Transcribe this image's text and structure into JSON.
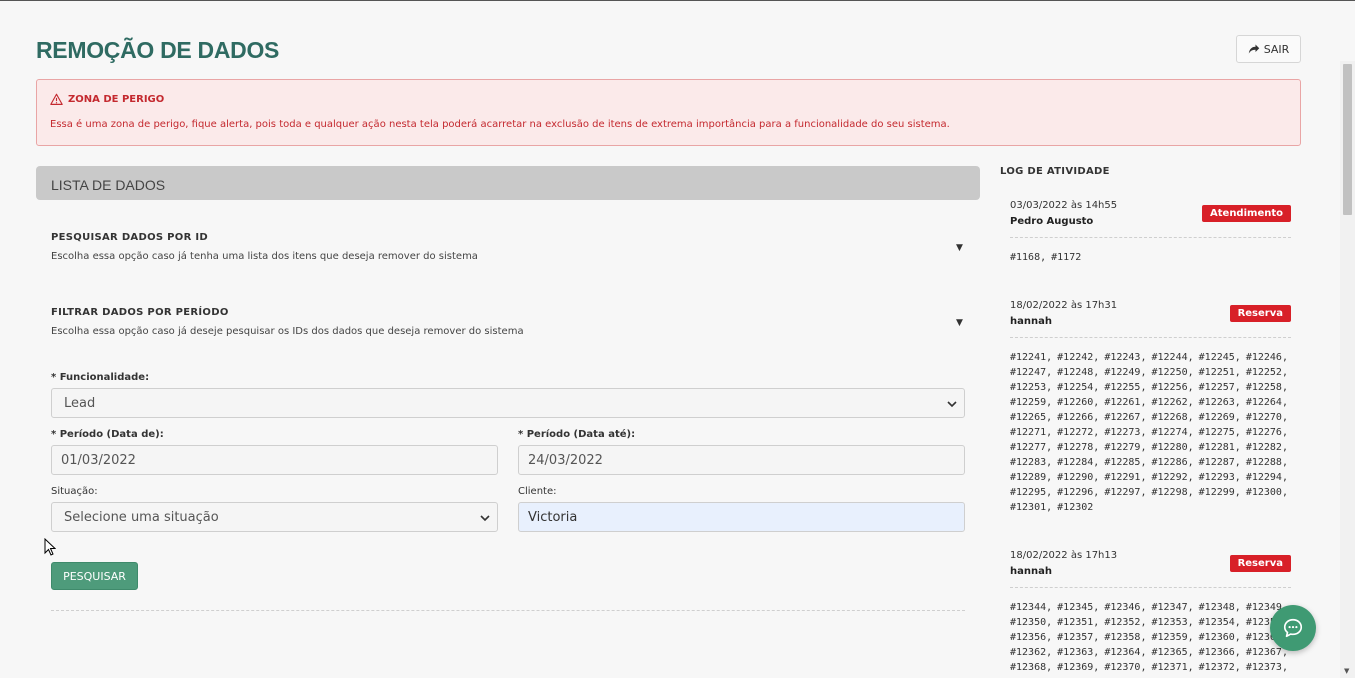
{
  "header": {
    "title": "REMOÇÃO DE DADOS",
    "exit_label": "SAIR"
  },
  "danger": {
    "title": "ZONA DE PERIGO",
    "text": "Essa é uma zona de perigo, fique alerta, pois toda e qualquer ação nesta tela poderá acarretar na exclusão de itens de extrema importância para a funcionalidade do seu sistema."
  },
  "list": {
    "header": "LISTA DE DADOS",
    "by_id": {
      "title": "PESQUISAR DADOS POR ID",
      "desc": "Escolha essa opção caso já tenha uma lista dos itens que deseja remover do sistema"
    },
    "by_period": {
      "title": "FILTRAR DADOS POR PERÍODO",
      "desc": "Escolha essa opção caso já deseje pesquisar os IDs dos dados que deseja remover do sistema"
    }
  },
  "form": {
    "functionality_label": "* Funcionalidade:",
    "functionality_value": "Lead",
    "date_from_label": "* Período (Data de):",
    "date_from_value": "01/03/2022",
    "date_to_label": "* Período (Data até):",
    "date_to_value": "24/03/2022",
    "status_label": "Situação:",
    "status_value": "Selecione uma situação",
    "client_label": "Cliente:",
    "client_value": "Victoria",
    "search_label": "PESQUISAR"
  },
  "log": {
    "title": "LOG DE ATIVIDADE",
    "badge_color": "#d82028",
    "entries": [
      {
        "date": "03/03/2022 às 14h55",
        "user": "Pedro Augusto",
        "badge": "Atendimento",
        "ids": "#1168, #1172"
      },
      {
        "date": "18/02/2022 às 17h31",
        "user": "hannah",
        "badge": "Reserva",
        "ids": "#12241, #12242, #12243, #12244, #12245, #12246, #12247, #12248, #12249, #12250, #12251, #12252, #12253, #12254, #12255, #12256, #12257, #12258, #12259, #12260, #12261, #12262, #12263, #12264, #12265, #12266, #12267, #12268, #12269, #12270, #12271, #12272, #12273, #12274, #12275, #12276, #12277, #12278, #12279, #12280, #12281, #12282, #12283, #12284, #12285, #12286, #12287, #12288, #12289, #12290, #12291, #12292, #12293, #12294, #12295, #12296, #12297, #12298, #12299, #12300, #12301, #12302"
      },
      {
        "date": "18/02/2022 às 17h13",
        "user": "hannah",
        "badge": "Reserva",
        "ids": "#12344, #12345, #12346, #12347, #12348, #12349, #12350, #12351, #12352, #12353, #12354, #12355, #12356, #12357, #12358, #12359, #12360, #12361, #12362, #12363, #12364, #12365, #12366, #12367, #12368, #12369, #12370, #12371, #12372, #12373,"
      }
    ]
  },
  "colors": {
    "title": "#2f6b62",
    "danger": "#c4292f",
    "primary_button": "#4e9b7b",
    "chat": "#3f9a73"
  }
}
